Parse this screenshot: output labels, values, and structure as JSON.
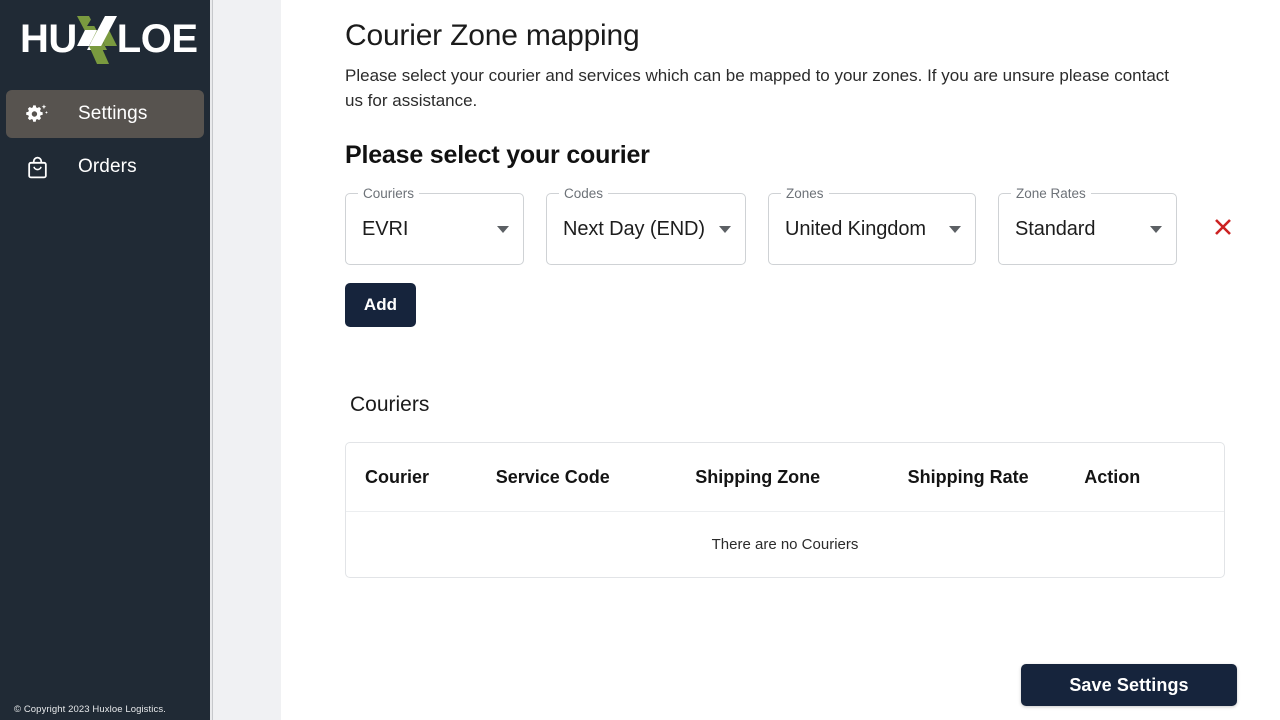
{
  "sidebar": {
    "logo": {
      "text_left": "HU",
      "text_right": "LOE",
      "mark_icon": "huxloe-x-mark-icon",
      "green": "#7a9a3f",
      "white": "#ffffff"
    },
    "items": [
      {
        "label": "Settings",
        "icon": "gear-sparkle-icon",
        "active": true
      },
      {
        "label": "Orders",
        "icon": "shopping-bag-icon",
        "active": false
      }
    ],
    "copyright": "© Copyright 2023 Huxloe Logistics.",
    "background": "#202a35",
    "active_background": "#57534f"
  },
  "main": {
    "page_title": "Courier Zone mapping",
    "page_subtitle": "Please select your courier and services which can be mapped to your zones. If you are unsure please contact us for assistance.",
    "section_title": "Please select your courier",
    "fields": [
      {
        "label": "Couriers",
        "value": "EVRI",
        "icon": "chevron-down-icon"
      },
      {
        "label": "Codes",
        "value": "Next Day (END)",
        "icon": "chevron-down-icon"
      },
      {
        "label": "Zones",
        "value": "United Kingdom",
        "icon": "chevron-down-icon"
      },
      {
        "label": "Zone Rates",
        "value": "Standard",
        "icon": "chevron-down-icon"
      }
    ],
    "remove_icon": "close-x-icon",
    "remove_color": "#cc2222",
    "add_label": "Add",
    "save_label": "Save Settings",
    "button_color": "#16243c",
    "table_heading": "Couriers",
    "table": {
      "columns": [
        "Courier",
        "Service Code",
        "Shipping Zone",
        "Shipping Rate",
        "Action"
      ],
      "rows": [],
      "empty_message": "There are no Couriers"
    }
  }
}
